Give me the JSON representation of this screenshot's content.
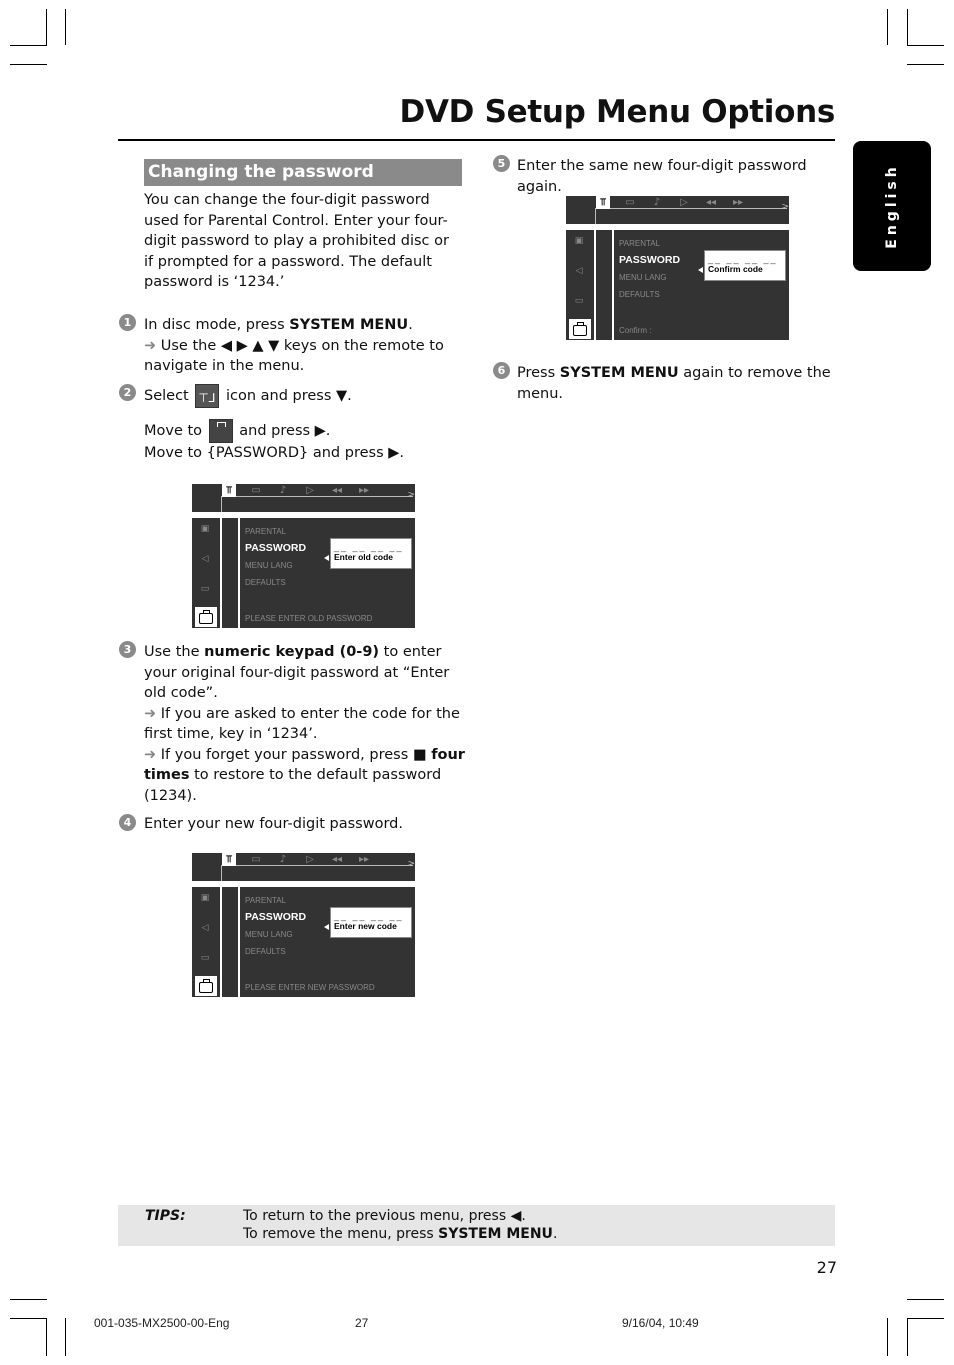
{
  "header": {
    "title": "DVD Setup Menu Options",
    "language_tab": "English"
  },
  "section": {
    "heading": "Changing the password",
    "intro": "You can change the four-digit password used for Parental Control.  Enter your four-digit password to play a prohibited disc or if prompted for a password. The default password is ‘1234.’"
  },
  "steps": [
    {
      "num": "1",
      "pre": "In disc mode, press ",
      "bold": "SYSTEM MENU",
      "post": ".",
      "note_pre": "Use the ◀ ▶ ▲ ▼ keys on the remote to navigate in the menu."
    },
    {
      "num": "2",
      "select_pre": "Select",
      "select_post": "icon and press ▼.",
      "move1_pre": "Move to",
      "move1_post": "and press ▶.",
      "move2": "Move to {PASSWORD} and press ▶."
    },
    {
      "num": "3",
      "pre": "Use the ",
      "bold": "numeric keypad (0-9)",
      "post": " to enter your original four-digit password at “Enter old code”.",
      "note1": "If you are asked to enter the code for the first time, key in ‘1234’.",
      "note2_pre": "If you forget your password, press ■ ",
      "note2_bold": "four times",
      "note2_post": " to restore to the default password (1234)."
    },
    {
      "num": "4",
      "text": "Enter your new four-digit password."
    },
    {
      "num": "5",
      "text": "Enter the same new four-digit password again."
    },
    {
      "num": "6",
      "pre": "Press ",
      "bold": "SYSTEM MENU",
      "post": " again to remove the menu."
    }
  ],
  "screens": [
    {
      "menu": [
        "PARENTAL",
        "PASSWORD",
        "MENU LANG",
        "DEFAULTS"
      ],
      "popup_label": "Enter old code",
      "dashes": "__ __ __ __",
      "message": "PLEASE ENTER OLD PASSWORD"
    },
    {
      "menu": [
        "PARENTAL",
        "PASSWORD",
        "MENU LANG",
        "DEFAULTS"
      ],
      "popup_label": "Enter new code",
      "dashes": "__ __ __ __",
      "message": "PLEASE ENTER NEW PASSWORD"
    },
    {
      "menu": [
        "PARENTAL",
        "PASSWORD",
        "MENU LANG",
        "DEFAULTS"
      ],
      "popup_label": "Confirm code",
      "dashes": "__ __ __ __",
      "message": "Confirm :"
    }
  ],
  "screen_icons": {
    "tabs": [
      "tools-icon",
      "subtitle-icon",
      "audio-icon",
      "play-icon",
      "rewind-icon",
      "forward-icon"
    ],
    "tab_glyphs": [
      "⫪",
      "▭",
      "♪",
      "▷",
      "◀◀",
      "▶▶"
    ]
  },
  "tips": {
    "label": "TIPS:",
    "line1": "To return to the previous menu, press ◀.",
    "line2_pre": "To remove the menu, press ",
    "line2_bold": "SYSTEM MENU",
    "line2_post": "."
  },
  "page_number": "27",
  "footer": {
    "file": "001-035-MX2500-00-Eng",
    "page": "27",
    "date": "9/16/04, 10:49"
  }
}
